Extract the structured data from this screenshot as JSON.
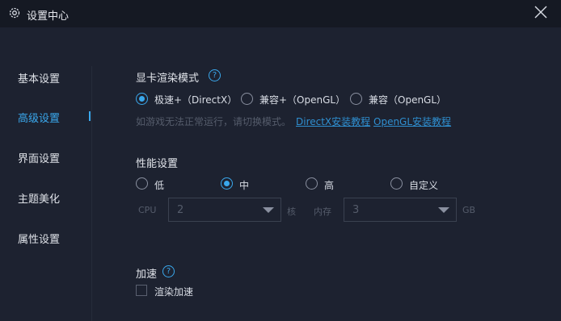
{
  "window": {
    "title": "设置中心"
  },
  "sidebar": {
    "items": [
      {
        "label": "基本设置"
      },
      {
        "label": "高级设置"
      },
      {
        "label": "界面设置"
      },
      {
        "label": "主题美化"
      },
      {
        "label": "属性设置"
      }
    ],
    "active": "高级设置"
  },
  "render": {
    "title": "显卡渲染模式",
    "options": [
      {
        "label": "极速+（DirectX）",
        "checked": true
      },
      {
        "label": "兼容+（OpenGL）",
        "checked": false
      },
      {
        "label": "兼容（OpenGL）",
        "checked": false
      }
    ],
    "hint": "如游戏无法正常运行，请切换模式。",
    "link_directx": "DirectX安装教程",
    "link_opengl": "OpenGL安装教程"
  },
  "performance": {
    "title": "性能设置",
    "options": [
      {
        "label": "低",
        "checked": false
      },
      {
        "label": "中",
        "checked": true
      },
      {
        "label": "高",
        "checked": false
      },
      {
        "label": "自定义",
        "checked": false
      }
    ],
    "cpu_label": "CPU",
    "cpu_value": "2",
    "cpu_unit": "核",
    "mem_label": "内存",
    "mem_value": "3",
    "mem_unit": "GB"
  },
  "accel": {
    "title": "加速",
    "checkbox_label": "渲染加速",
    "checked": false
  },
  "colors": {
    "accent": "#3aa8ec",
    "background": "#1d2230",
    "titlebar": "#151923"
  }
}
